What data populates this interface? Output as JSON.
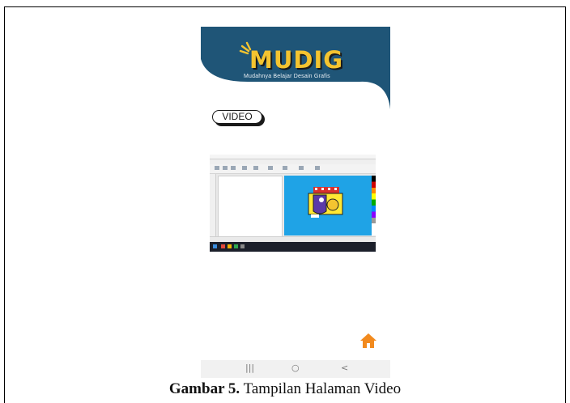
{
  "app": {
    "logo_title": "MUDIG",
    "logo_subtitle": "Mudahnya Belajar Desain Grafis",
    "brand_color": "#1f5577",
    "logo_color": "#f4c430"
  },
  "section": {
    "video_label": "VIDEO"
  },
  "video": {
    "thumbnail_icon": "design-software-screenshot"
  },
  "home_button": {
    "icon": "home-icon",
    "color": "#f28a1e"
  },
  "system_nav": {
    "recents_glyph": "|||",
    "home_glyph": "○",
    "back_glyph": "<"
  },
  "caption": {
    "label": "Gambar 5.",
    "text": " Tampilan Halaman Video"
  }
}
